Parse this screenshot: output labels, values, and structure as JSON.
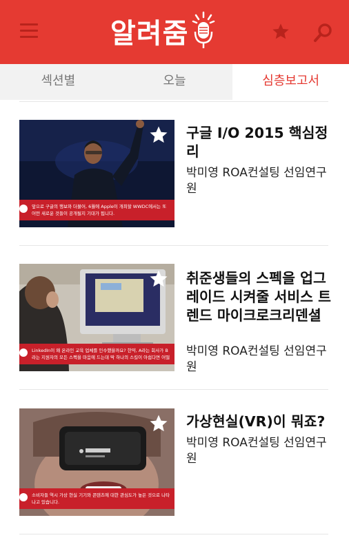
{
  "app": {
    "logo_text": "알려줌",
    "brand_color": "#e53a32"
  },
  "icons": {
    "menu": "hamburger-menu-icon",
    "logo": "microphone-logo-icon",
    "favorite": "star-icon",
    "search": "search-icon"
  },
  "tabs": [
    {
      "label": "섹션별",
      "active": false
    },
    {
      "label": "오늘",
      "active": false
    },
    {
      "label": "심층보고서",
      "active": true
    }
  ],
  "articles": [
    {
      "title": "구글 I/O 2015 핵심정리",
      "author": "박미영 ROA컨설팅 선임연구원",
      "caption": "앞으로 구글의 행보와 더불어, 6월에 Apple이 개최할 WWDC에서는 또 어떤 새로운 것들이 공개될지 기대가 됩니다."
    },
    {
      "title": "취준생들의 스펙을 업그레이드 시켜줄 서비스 트렌드 마이크로크리덴셜",
      "author": "박미영 ROA컨설팅 선임연구원",
      "caption": "LinkedIn이 왜 온라인 교육 업체를 인수했을까요? 한약, A라는 회사가 B라는 지원자의 모든 스펙을 마음에 드는데 딱 하나의 스킬이 아쉽다면 어떨"
    },
    {
      "title": "가상현실(VR)이 뭐죠?",
      "author": "박미영 ROA컨설팅 선임연구원",
      "caption": "소비자들 역시 가상 현실 기기와 콘텐츠에 대한 관심도가 높은 것으로 나타나고 있습니다."
    }
  ]
}
